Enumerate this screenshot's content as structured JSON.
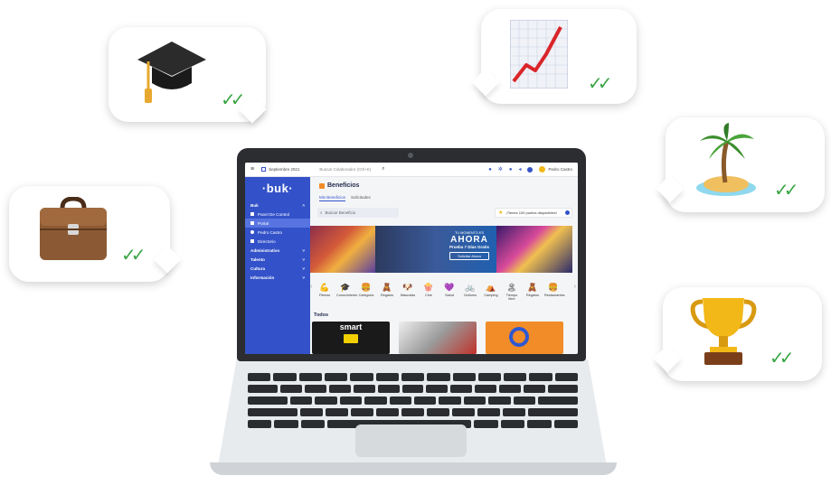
{
  "bubbles": {
    "graduation": {
      "icon": "graduation-cap-icon",
      "check": "✓✓"
    },
    "chart": {
      "icon": "chart-increasing-icon",
      "check": "✓✓"
    },
    "island": {
      "icon": "palm-island-icon",
      "check": "✓✓"
    },
    "briefcase": {
      "icon": "briefcase-icon",
      "check": "✓✓"
    },
    "trophy": {
      "icon": "trophy-icon",
      "check": "✓✓"
    }
  },
  "app": {
    "period": "Septiembre 2021",
    "search_placeholder": "Buscar Colaborador (Ctrl+K)",
    "user_name": "Pedro Castro",
    "logo": "·buk·",
    "sidebar": [
      {
        "label": "Buk",
        "kind": "section"
      },
      {
        "label": "Panel De Control",
        "kind": "item"
      },
      {
        "label": "Portal",
        "kind": "item",
        "active": true
      },
      {
        "label": "Pedro Castro",
        "kind": "item"
      },
      {
        "label": "Directorio",
        "kind": "item"
      },
      {
        "label": "Administrativo",
        "kind": "section"
      },
      {
        "label": "Talento",
        "kind": "section"
      },
      {
        "label": "Cultura",
        "kind": "section"
      },
      {
        "label": "Información",
        "kind": "section"
      }
    ],
    "page_title": "Beneficios",
    "tabs": [
      "Mis Beneficios",
      "Solicitudes"
    ],
    "benefit_search": "Buscar Beneficio",
    "points_text": "¡Tienes 100 puntos disponibles!",
    "promo": {
      "kicker": "TU MOMENTO ES",
      "headline": "AHORA",
      "sub": "Prueba 7 Días Gratis",
      "cta": "Solicitar Ahora"
    },
    "categories": [
      {
        "icon": "💪",
        "label": "Fitness"
      },
      {
        "icon": "🎓",
        "label": "Conocimiento"
      },
      {
        "icon": "🍔",
        "label": "Categoría"
      },
      {
        "icon": "🧸",
        "label": "Regalos"
      },
      {
        "icon": "🐶",
        "label": "Mascotas"
      },
      {
        "icon": "🍿",
        "label": "Cine"
      },
      {
        "icon": "💜",
        "label": "Salud"
      },
      {
        "icon": "🚲",
        "label": "Ciclismo"
      },
      {
        "icon": "⛺",
        "label": "Camping"
      },
      {
        "icon": "🏝",
        "label": "Tiempo libre"
      },
      {
        "icon": "🧸",
        "label": "Regalos"
      },
      {
        "icon": "🍔",
        "label": "Restaurantes"
      }
    ],
    "section_all": "Todos",
    "card_brand": "smart"
  }
}
